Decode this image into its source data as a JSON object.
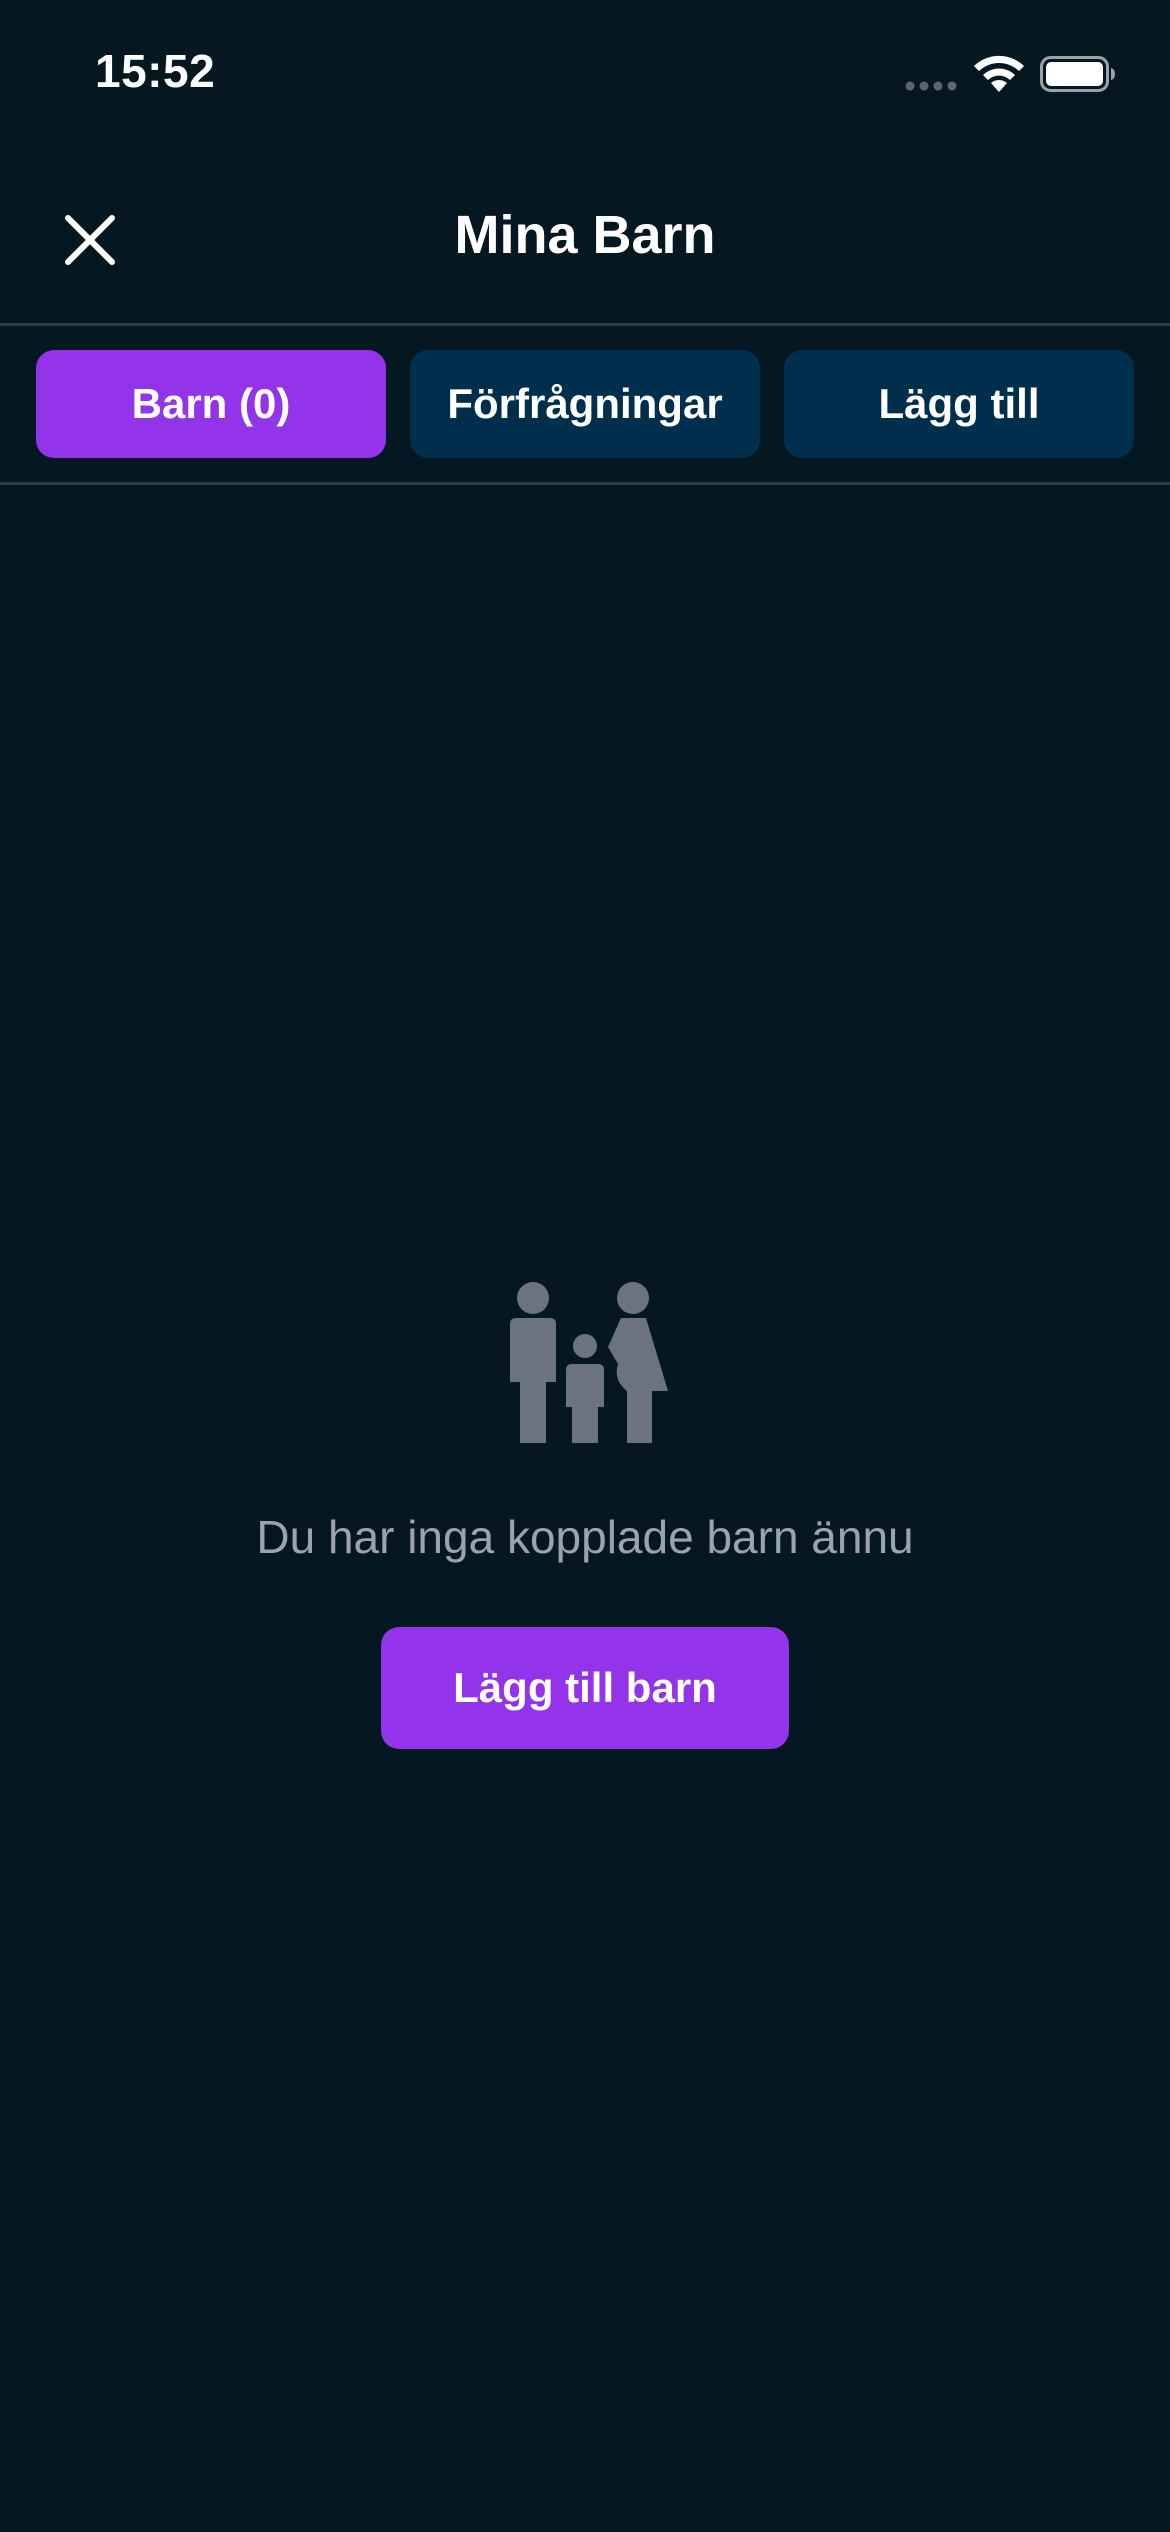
{
  "status_bar": {
    "time": "15:52",
    "icons": [
      "cellular-signal-icon",
      "wifi-icon",
      "battery-icon"
    ]
  },
  "header": {
    "title": "Mina Barn",
    "close_icon": "close-icon"
  },
  "tabs": [
    {
      "label": "Barn (0)",
      "active": true
    },
    {
      "label": "Förfrågningar",
      "active": false
    },
    {
      "label": "Lägg till",
      "active": false
    }
  ],
  "empty_state": {
    "icon": "family-icon",
    "message": "Du har inga kopplade barn ännu",
    "button_label": "Lägg till barn"
  },
  "colors": {
    "background": "#051821",
    "accent": "#9333ea",
    "tab_inactive": "#002e4d",
    "muted_text": "#9ca3af",
    "icon_gray": "#6b7280"
  }
}
